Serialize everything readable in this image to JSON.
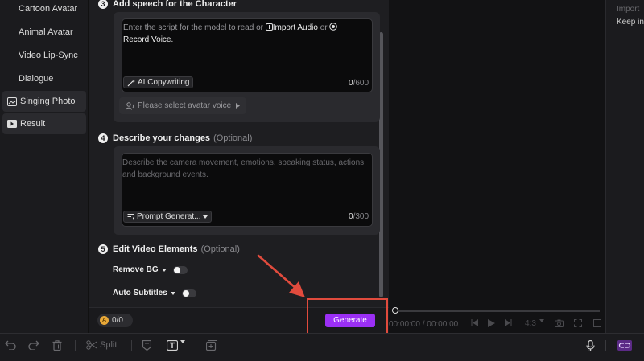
{
  "sidebar": {
    "items": [
      {
        "label": "Cartoon Avatar",
        "icon": ""
      },
      {
        "label": "Animal Avatar",
        "icon": ""
      },
      {
        "label": "Video Lip-Sync",
        "icon": ""
      },
      {
        "label": "Dialogue",
        "icon": ""
      },
      {
        "label": "Singing Photo",
        "icon": "photo-music-icon"
      },
      {
        "label": "Result",
        "icon": "play-folder-icon"
      }
    ]
  },
  "step3": {
    "number": "3",
    "title": "Add speech for the Character",
    "prompt_pre": "Enter the script for the model to read or",
    "import_audio": "Import Audio",
    "or": "or",
    "record_voice": "Record Voice",
    "period": ".",
    "ai_copywriting": "AI Copywriting",
    "counter_current": "0",
    "counter_max": "/600",
    "voice_select": "Please select avatar voice"
  },
  "step4": {
    "number": "4",
    "title": "Describe your changes",
    "optional": "(Optional)",
    "placeholder": "Describe the camera movement, emotions, speaking status, actions, and background events.",
    "prompt_generator": "Prompt Generat...",
    "counter_current": "0",
    "counter_max": "/300"
  },
  "step5": {
    "number": "5",
    "title": "Edit Video Elements",
    "optional": "(Optional)",
    "remove_bg": "Remove BG",
    "auto_subtitles": "Auto Subtitles"
  },
  "footer": {
    "credits": "0/0",
    "generate": "Generate"
  },
  "preview": {
    "current_time": "00:00:00",
    "separator": "/",
    "total_time": "00:00:00",
    "aspect_ratio": "4:3"
  },
  "right_panel": {
    "line1": "Import",
    "line2": "Keep in"
  },
  "toolbar": {
    "split": "Split"
  },
  "colors": {
    "accent": "#9b2ff5",
    "annotation": "#e14b3d"
  }
}
